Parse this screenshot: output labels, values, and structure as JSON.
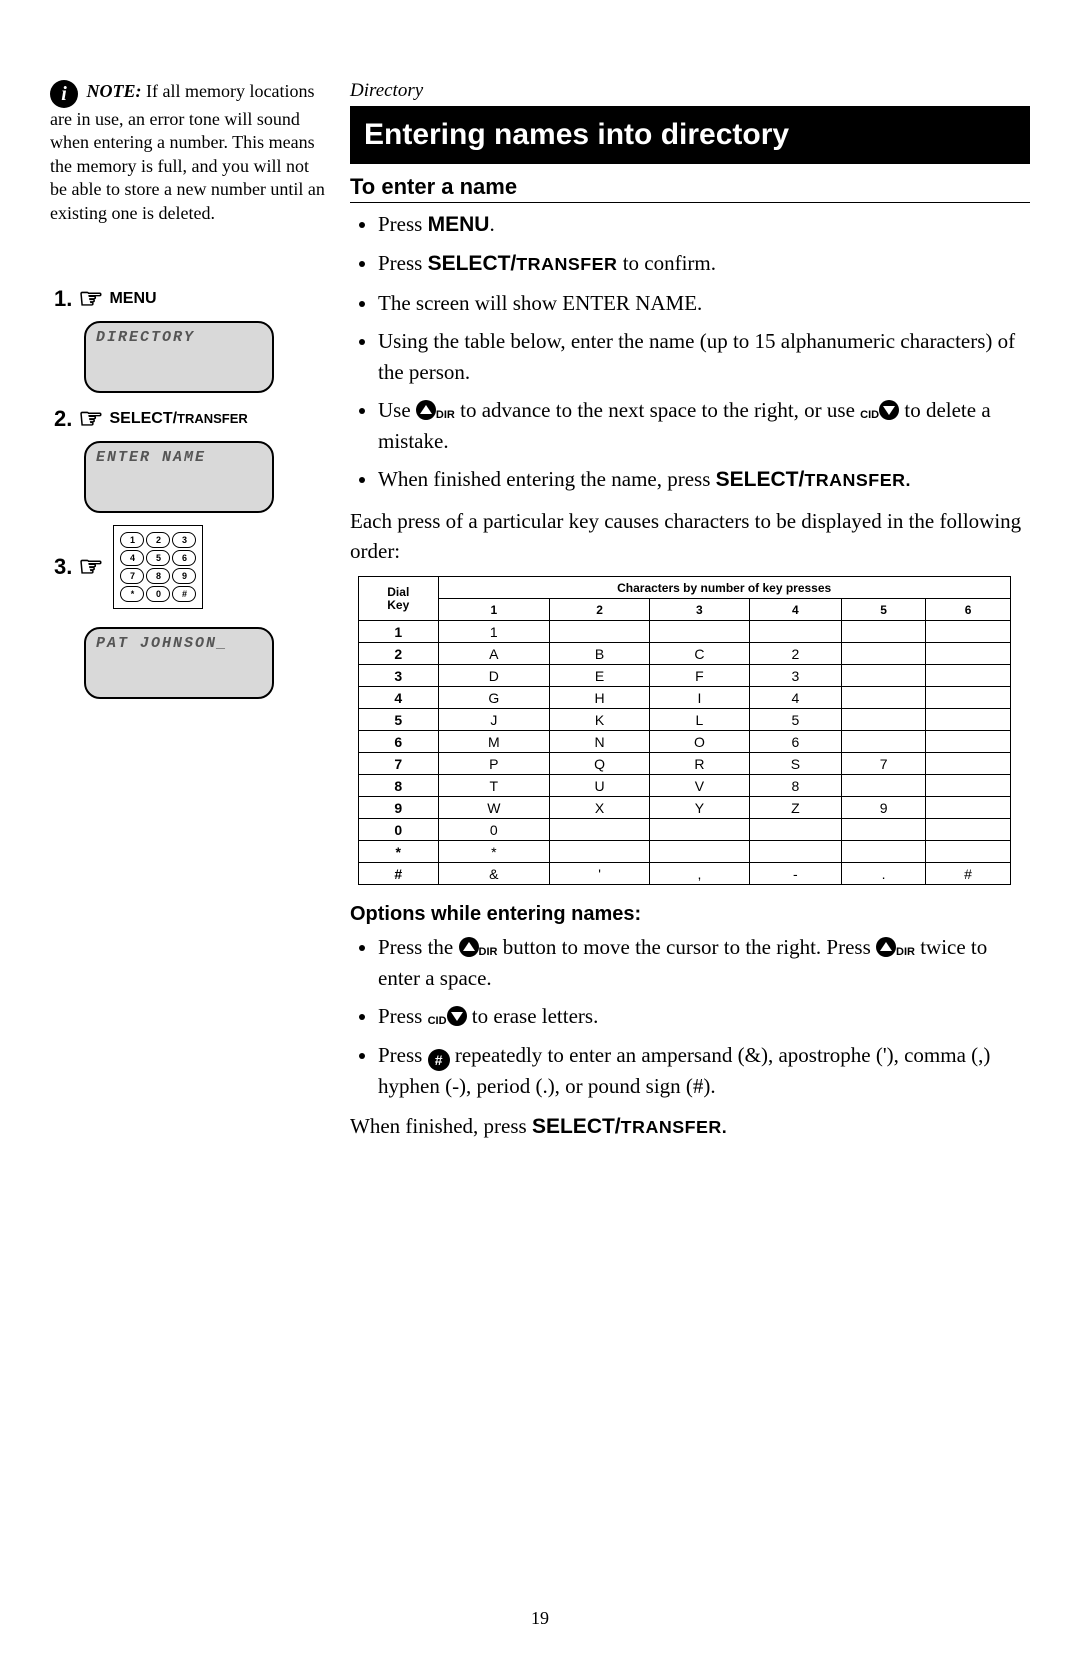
{
  "note": {
    "label": "NOTE:",
    "text": " If all memory locations are in use, an error tone will sound when entering a number. This means the memory is full, and you will not be able to store a new number until an existing one is deleted."
  },
  "steps": {
    "s1": {
      "num": "1.",
      "label": "MENU"
    },
    "s2": {
      "num": "2.",
      "label_a": "SELECT/",
      "label_b": "TRANSFER"
    },
    "s3": {
      "num": "3."
    },
    "lcd1": "DIRECTORY",
    "lcd2": "ENTER NAME",
    "lcd3": "PAT JOHNSON_",
    "keypad": [
      [
        "1",
        "2",
        "3"
      ],
      [
        "4",
        "5",
        "6"
      ],
      [
        "7",
        "8",
        "9"
      ],
      [
        "*",
        "0",
        "#"
      ]
    ]
  },
  "section_label": "Directory",
  "title": "Entering names into directory",
  "sub1": "To enter a name",
  "bullets1": {
    "b1a": "Press ",
    "b1b": "MENU",
    "b1c": ".",
    "b2a": "Press ",
    "b2b": "SELECT/",
    "b2c": "TRANSFER",
    "b2d": " to confirm.",
    "b3": "The screen will show ENTER NAME.",
    "b4": "Using the table below, enter the name (up to 15 alphanumeric characters) of the person.",
    "b5a": "Use ",
    "b5b": "DIR",
    "b5c": " to advance to the next space to the right, or use ",
    "b5d": "CID",
    "b5e": " to delete a mistake.",
    "b6a": "When finished entering the name, press ",
    "b6b": "SELECT/",
    "b6c": "TRANSFER."
  },
  "para1": "Each press of a particular key causes characters to be displayed in the following order:",
  "chart_data": {
    "type": "table",
    "title": "Characters by number of key presses",
    "row_header": "Dial Key",
    "columns": [
      "1",
      "2",
      "3",
      "4",
      "5",
      "6"
    ],
    "rows": [
      {
        "key": "1",
        "cells": [
          "1",
          "",
          "",
          "",
          "",
          ""
        ]
      },
      {
        "key": "2",
        "cells": [
          "A",
          "B",
          "C",
          "2",
          "",
          ""
        ]
      },
      {
        "key": "3",
        "cells": [
          "D",
          "E",
          "F",
          "3",
          "",
          ""
        ]
      },
      {
        "key": "4",
        "cells": [
          "G",
          "H",
          "I",
          "4",
          "",
          ""
        ]
      },
      {
        "key": "5",
        "cells": [
          "J",
          "K",
          "L",
          "5",
          "",
          ""
        ]
      },
      {
        "key": "6",
        "cells": [
          "M",
          "N",
          "O",
          "6",
          "",
          ""
        ]
      },
      {
        "key": "7",
        "cells": [
          "P",
          "Q",
          "R",
          "S",
          "7",
          ""
        ]
      },
      {
        "key": "8",
        "cells": [
          "T",
          "U",
          "V",
          "8",
          "",
          ""
        ]
      },
      {
        "key": "9",
        "cells": [
          "W",
          "X",
          "Y",
          "Z",
          "9",
          ""
        ]
      },
      {
        "key": "0",
        "cells": [
          "0",
          "",
          "",
          "",
          "",
          ""
        ]
      },
      {
        "key": "*",
        "cells": [
          "*",
          "",
          "",
          "",
          "",
          ""
        ]
      },
      {
        "key": "#",
        "cells": [
          "&",
          "'",
          ",",
          "-",
          ".",
          "#"
        ]
      }
    ]
  },
  "sub2": "Options while entering names:",
  "bullets2": {
    "b1a": "Press the ",
    "b1b": "DIR",
    "b1c": " button to move the cursor to the right. Press ",
    "b1d": "DIR",
    "b1e": " twice to enter a space.",
    "b2a": "Press ",
    "b2b": "CID",
    "b2c": " to erase letters.",
    "b3a": "Press ",
    "b3b": " repeatedly to enter an ampersand (&), apostrophe ('), comma (,) hyphen (-), period (.), or pound sign (#)."
  },
  "closing_a": "When finished, press ",
  "closing_b": "SELECT/",
  "closing_c": "TRANSFER.",
  "page_number": "19"
}
